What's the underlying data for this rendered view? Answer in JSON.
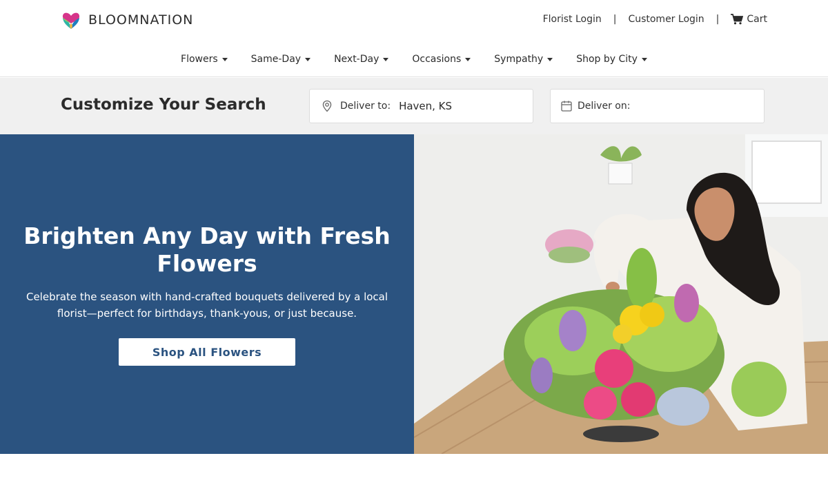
{
  "brand": {
    "name": "BLOOMNATION"
  },
  "top_links": {
    "florist_login": "Florist Login",
    "separator": "|",
    "customer_login": "Customer Login",
    "cart": "Cart",
    "cart_icon": "shopping-cart-icon"
  },
  "nav": {
    "items": [
      {
        "label": "Flowers"
      },
      {
        "label": "Same-Day"
      },
      {
        "label": "Next-Day"
      },
      {
        "label": "Occasions"
      },
      {
        "label": "Sympathy"
      },
      {
        "label": "Shop by City"
      }
    ]
  },
  "search": {
    "title": "Customize Your Search",
    "deliver_to": {
      "label": "Deliver to:",
      "value": "Haven, KS",
      "icon": "location-pin-icon"
    },
    "deliver_on": {
      "label": "Deliver on:",
      "value": "",
      "icon": "calendar-icon"
    }
  },
  "hero": {
    "title": "Brighten Any Day with Fresh Flowers",
    "subtitle": "Celebrate the season with hand-crafted bouquets delivered by a local florist—perfect for birthdays, thank-yous, or just because.",
    "cta": "Shop All Flowers",
    "photo": "florist-arranging-bouquet-photo"
  },
  "colors": {
    "hero_bg": "#2b5380",
    "search_band_bg": "#f0f0f0",
    "text": "#2b2b2b",
    "cta_bg": "#ffffff",
    "cta_text": "#2b5380"
  }
}
